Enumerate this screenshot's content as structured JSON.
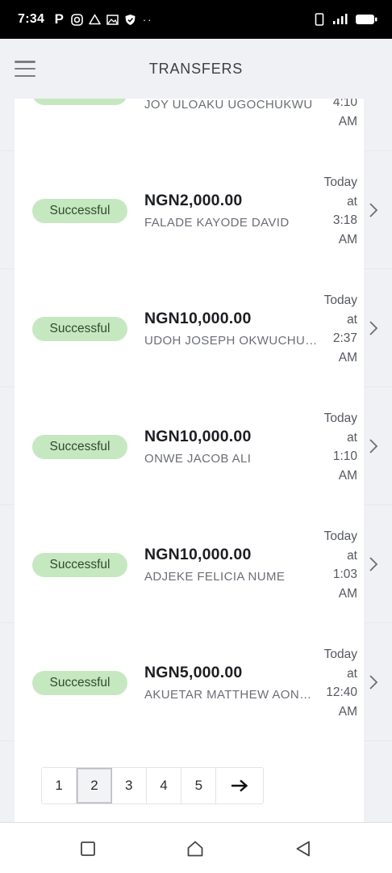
{
  "status_bar": {
    "time": "7:34",
    "left_icons": [
      "paypal-icon",
      "instagram-icon",
      "drive-icon",
      "gallery-icon",
      "shield-icon",
      "more-dots-icon"
    ],
    "right_icons": [
      "vibrate-icon",
      "signal-icon",
      "battery-icon"
    ]
  },
  "header": {
    "title": "TRANSFERS",
    "menu_icon": "hamburger-icon"
  },
  "partial_row": {
    "name": "JOY ULOAKU UGOCHUKWU",
    "time_line3": "4:10",
    "time_line4": "AM"
  },
  "transfers": [
    {
      "status": "Successful",
      "amount": "NGN2,000.00",
      "name": "FALADE KAYODE DAVID",
      "day": "Today",
      "at": "at",
      "time": "3:18",
      "ampm": "AM"
    },
    {
      "status": "Successful",
      "amount": "NGN10,000.00",
      "name": "UDOH JOSEPH OKWUCHUK…",
      "day": "Today",
      "at": "at",
      "time": "2:37",
      "ampm": "AM"
    },
    {
      "status": "Successful",
      "amount": "NGN10,000.00",
      "name": "ONWE JACOB ALI",
      "day": "Today",
      "at": "at",
      "time": "1:10",
      "ampm": "AM"
    },
    {
      "status": "Successful",
      "amount": "NGN10,000.00",
      "name": "ADJEKE FELICIA NUME",
      "day": "Today",
      "at": "at",
      "time": "1:03",
      "ampm": "AM"
    },
    {
      "status": "Successful",
      "amount": "NGN5,000.00",
      "name": "AKUETAR MATTHEW AOND…",
      "day": "Today",
      "at": "at",
      "time": "12:40",
      "ampm": "AM"
    }
  ],
  "pagination": {
    "pages": [
      "1",
      "2",
      "3",
      "4",
      "5"
    ],
    "current": "2",
    "next_label": "→"
  },
  "colors": {
    "success_badge_bg": "#c6e8c1",
    "success_badge_text": "#2f4a2c",
    "page_bg": "#f0f1f4"
  },
  "nav_bar": {
    "buttons": [
      "recents-square-icon",
      "home-icon",
      "back-triangle-icon"
    ]
  }
}
